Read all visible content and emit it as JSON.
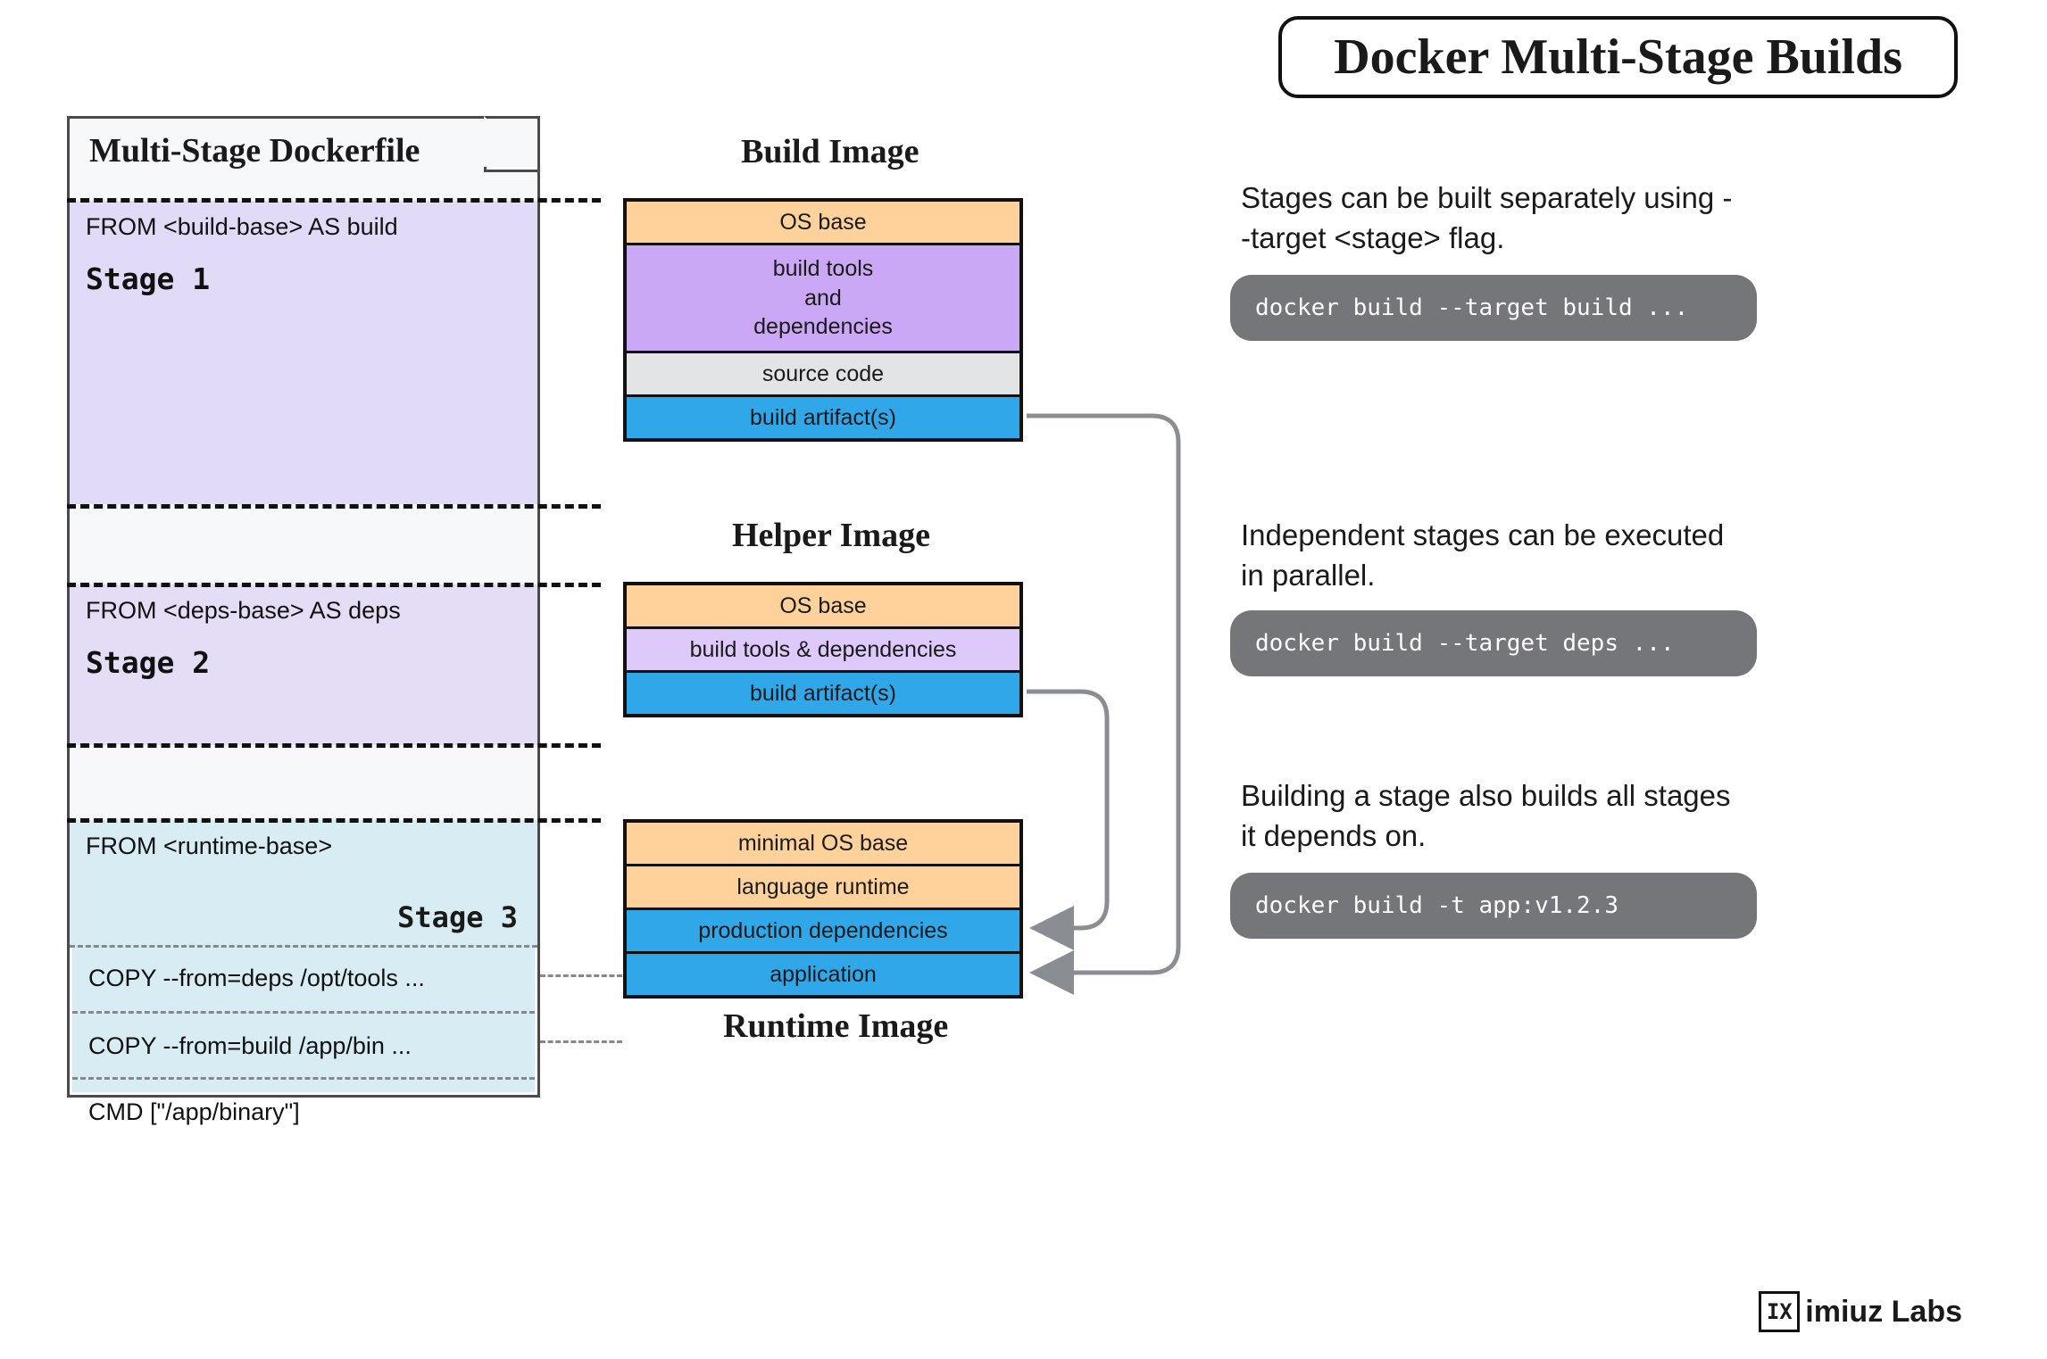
{
  "title": "Docker Multi-Stage Builds",
  "dockerfile": {
    "heading": "Multi-Stage Dockerfile",
    "stage1": {
      "from": "FROM <build-base> AS build",
      "label": "Stage 1"
    },
    "stage2": {
      "from": "FROM <deps-base> AS deps",
      "label": "Stage 2"
    },
    "stage3": {
      "from": "FROM <runtime-base>",
      "label": "Stage 3",
      "copy_deps": "COPY  --from=deps /opt/tools ...",
      "copy_build": "COPY  --from=build /app/bin ...",
      "cmd": "CMD [\"/app/binary\"]"
    }
  },
  "images": {
    "build": {
      "title": "Build Image",
      "layers": [
        "OS base",
        "build tools\nand\ndependencies",
        "source code",
        "build artifact(s)"
      ]
    },
    "helper": {
      "title": "Helper Image",
      "layers": [
        "OS base",
        "build tools & dependencies",
        "build artifact(s)"
      ]
    },
    "runtime": {
      "title": "Runtime Image",
      "layers": [
        "minimal OS base",
        "language runtime",
        "production dependencies",
        "application"
      ]
    }
  },
  "notes": {
    "n1": {
      "text": "Stages can be built separately using --target <stage> flag.",
      "code": "docker build --target build ..."
    },
    "n2": {
      "text": "Independent stages can be executed in parallel.",
      "code": "docker build --target deps ..."
    },
    "n3": {
      "text": "Building a stage also builds all stages it depends on.",
      "code": "docker build -t app:v1.2.3"
    }
  },
  "brand": "imiuz Labs"
}
